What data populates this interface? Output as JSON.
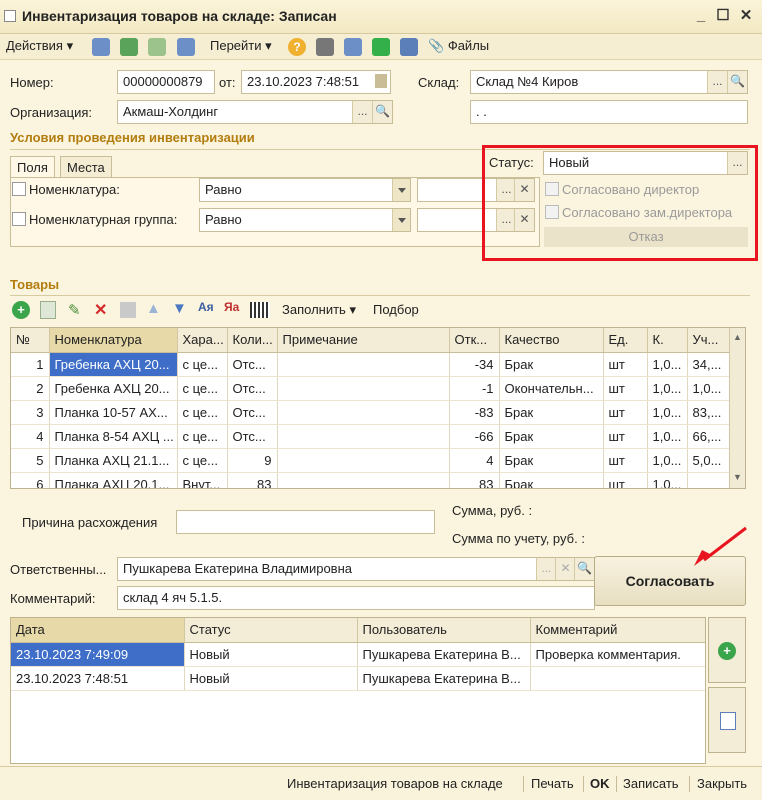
{
  "window": {
    "title": "Инвентаризация товаров на складе: Записан"
  },
  "toolbar": {
    "actions": "Действия",
    "goto": "Перейти",
    "files": "Файлы"
  },
  "header": {
    "number_label": "Номер:",
    "number": "00000000879",
    "date_label": "от:",
    "date": "23.10.2023  7:48:51",
    "warehouse_label": "Склад:",
    "warehouse": "Склад №4 Киров",
    "org_label": "Организация:",
    "org": "Акмаш-Холдинг",
    "extra_field": ".  ."
  },
  "conditions": {
    "title": "Условия проведения инвентаризации",
    "tabs": [
      "Поля",
      "Места"
    ],
    "rows": [
      {
        "label": "Номенклатура:",
        "condition": "Равно"
      },
      {
        "label": "Номенклатурная группа:",
        "condition": "Равно"
      }
    ]
  },
  "status": {
    "label": "Статус:",
    "value": "Новый",
    "approved_director": "Согласовано директор",
    "approved_deputy": "Согласовано зам.директора",
    "reject": "Отказ"
  },
  "goods": {
    "title": "Товары",
    "fill": "Заполнить",
    "pick": "Подбор",
    "columns": [
      "№",
      "Номенклатура",
      "Хара...",
      "Коли...",
      "Примечание",
      "Отк...",
      "Качество",
      "Ед.",
      "К.",
      "Уч..."
    ],
    "rows": [
      [
        "1",
        "Гребенка АХЦ 20...",
        "с це...",
        "Отс...",
        "",
        "-34",
        "Брак",
        "шт",
        "1,0...",
        "34,..."
      ],
      [
        "2",
        "Гребенка АХЦ 20...",
        "с це...",
        "Отс...",
        "",
        "-1",
        "Окончательн...",
        "шт",
        "1,0...",
        "1,0..."
      ],
      [
        "3",
        "Планка 10-57 АХ...",
        "с це...",
        "Отс...",
        "",
        "-83",
        "Брак",
        "шт",
        "1,0...",
        "83,..."
      ],
      [
        "4",
        "Планка 8-54 АХЦ ...",
        "с це...",
        "Отс...",
        "",
        "-66",
        "Брак",
        "шт",
        "1,0...",
        "66,..."
      ],
      [
        "5",
        "Планка АХЦ 21.1...",
        "с це...",
        "9",
        "",
        "4",
        "Брак",
        "шт",
        "1,0...",
        "5,0..."
      ],
      [
        "6",
        "Планка АХЦ 20.1...",
        "Внут...",
        "83",
        "",
        "83",
        "Брак",
        "шт",
        "1,0...",
        ""
      ]
    ]
  },
  "discrepancy": {
    "reason_label": "Причина расхождения",
    "sum_label": "Сумма, руб. :",
    "sum_acc_label": "Сумма по учету, руб. :"
  },
  "responsible": {
    "label": "Ответственны...",
    "value": "Пушкарева Екатерина Владимировна"
  },
  "comment": {
    "label": "Комментарий:",
    "value": "склад 4 яч 5.1.5."
  },
  "approve_button": "Согласовать",
  "history": {
    "columns": [
      "Дата",
      "Статус",
      "Пользователь",
      "Комментарий"
    ],
    "rows": [
      [
        "23.10.2023 7:49:09",
        "Новый",
        "Пушкарева Екатерина В...",
        "Проверка комментария."
      ],
      [
        "23.10.2023 7:48:51",
        "Новый",
        "Пушкарева Екатерина В...",
        ""
      ]
    ]
  },
  "footer": {
    "doc": "Инвентаризация товаров на складе",
    "print": "Печать",
    "ok": "OK",
    "save": "Записать",
    "close": "Закрыть"
  },
  "colors": {
    "accent_title": "#b37d10",
    "highlight": "#e8141f",
    "selection": "#3e6ec8"
  }
}
